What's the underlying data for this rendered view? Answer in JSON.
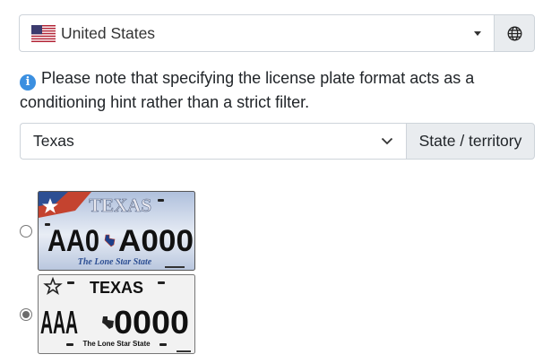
{
  "country_select": {
    "value": "United States",
    "flag_icon": "us-flag-icon",
    "addon_icon": "globe-icon"
  },
  "note": {
    "icon": "info-icon",
    "text": "Please note that specifying the license plate format acts as a conditioning hint rather than a strict filter."
  },
  "state_select": {
    "value": "Texas",
    "addon_label": "State / territory"
  },
  "plates": [
    {
      "checked": false,
      "state_text": "TEXAS",
      "number": "AA0 A000",
      "slogan": "The Lone Star State"
    },
    {
      "checked": true,
      "state_text": "TEXAS",
      "number": "AAA 0000",
      "slogan": "The Lone Star State"
    }
  ],
  "colors": {
    "info_blue": "#3b8fe0",
    "addon_bg": "#e9ecef",
    "border": "#ced4da"
  }
}
